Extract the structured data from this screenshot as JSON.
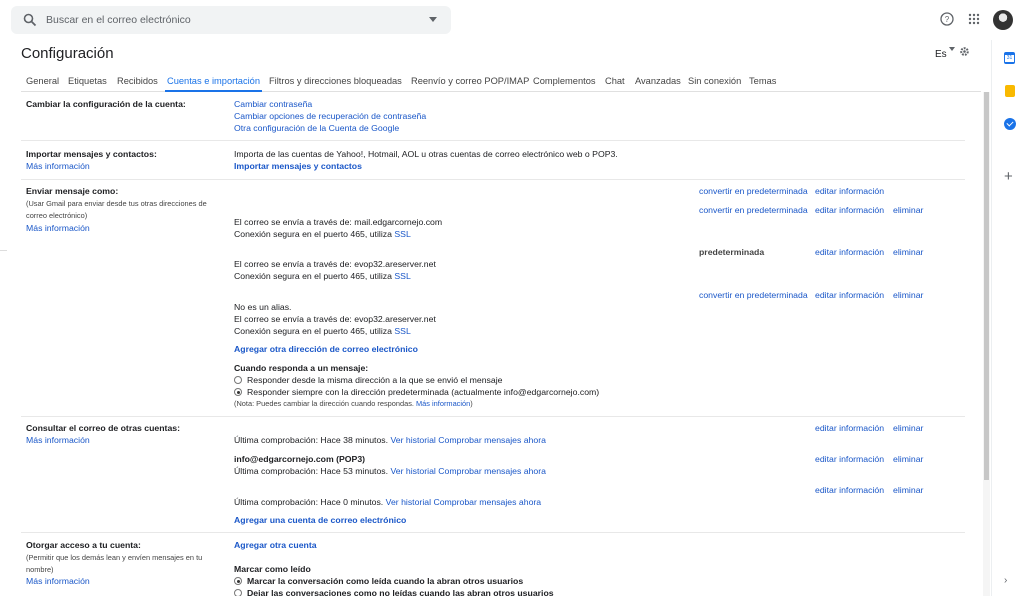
{
  "search": {
    "placeholder": "Buscar en el correo electrónico"
  },
  "header": {
    "title": "Configuración",
    "language": "Es"
  },
  "tabs": [
    {
      "label": "General"
    },
    {
      "label": "Etiquetas"
    },
    {
      "label": "Recibidos"
    },
    {
      "label": "Cuentas e importación",
      "active": true
    },
    {
      "label": "Filtros y direcciones bloqueadas"
    },
    {
      "label": "Reenvío y correo POP/IMAP"
    },
    {
      "label": "Complementos"
    },
    {
      "label": "Chat"
    },
    {
      "label": "Avanzadas"
    },
    {
      "label": "Sin conexión"
    },
    {
      "label": "Temas"
    }
  ],
  "side_panel": {
    "calendar_day": "31"
  },
  "account": {
    "label": "Cambiar la configuración de la cuenta:",
    "links": [
      "Cambiar contraseña",
      "Cambiar opciones de recuperación de contraseña",
      "Otra configuración de la Cuenta de Google"
    ]
  },
  "import": {
    "label": "Importar mensajes y contactos:",
    "more": "Más información",
    "desc": "Importa de las cuentas de Yahoo!, Hotmail, AOL u otras cuentas de correo electrónico web o POP3.",
    "action": "Importar mensajes y contactos"
  },
  "send_as": {
    "label": "Enviar mensaje como:",
    "sub1": "(Usar Gmail para enviar desde tus otras direcciones de",
    "sub2": "correo electrónico)",
    "more": "Más información",
    "make_default": "convertir en predeterminada",
    "edit": "editar información",
    "delete": "eliminar",
    "default_label": "predeterminada",
    "via1": "El correo se envía a través de: mail.edgarcornejo.com",
    "secure": "Conexión segura en el puerto 465, utiliza",
    "ssl": "SSL",
    "via2": "El correo se envía a través de: evop32.areserver.net",
    "not_alias": "No es un alias.",
    "add": "Agregar otra dirección de correo electrónico",
    "reply_title": "Cuando responda a un mensaje:",
    "reply_opt1": "Responder desde la misma dirección a la que se envió el mensaje",
    "reply_opt2": "Responder siempre con la dirección predeterminada (actualmente info@edgarcornejo.com)",
    "note": "(Nota: Puedes cambiar la dirección cuando respondas.",
    "note_link": "Más información",
    "note_end": ")"
  },
  "check_mail": {
    "label": "Consultar el correo de otras cuentas:",
    "more": "Más información",
    "last_check": "Última comprobación: Hace 38 minutos.",
    "history": "Ver historial",
    "check_now": "Comprobar mensajes ahora",
    "account2": "info@edgarcornejo.com (POP3)",
    "last_check2": "Última comprobación: Hace 53 minutos.",
    "last_check3": "Última comprobación: Hace 0 minutos.",
    "edit": "editar información",
    "delete": "eliminar",
    "add": "Agregar una cuenta de correo electrónico"
  },
  "grant": {
    "label": "Otorgar acceso a tu cuenta:",
    "sub1": "(Permitir que los demás lean y envíen mensajes en tu",
    "sub2": "nombre)",
    "more": "Más información",
    "add": "Agregar otra cuenta",
    "mark_title": "Marcar como leído",
    "opt1": "Marcar la conversación como leída cuando la abran otros usuarios",
    "opt2": "Dejar las conversaciones como no leídas cuando las abran otros usuarios"
  }
}
